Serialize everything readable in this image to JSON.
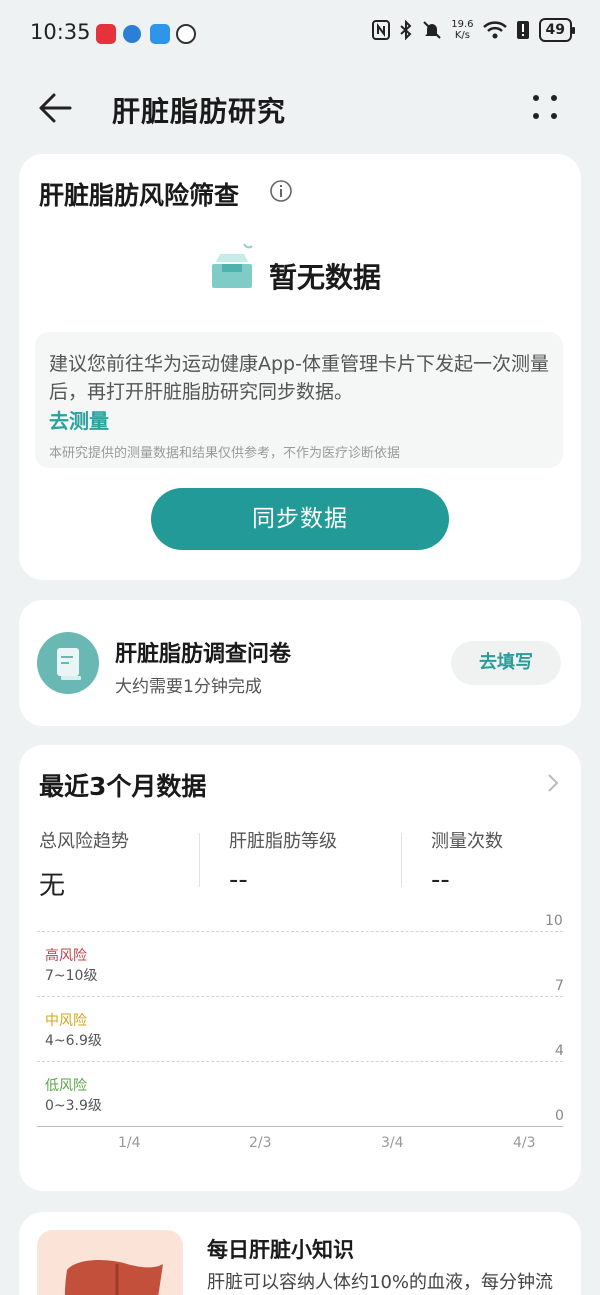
{
  "status_bar": {
    "time": "10:35",
    "net_speed_top": "19.6",
    "net_speed_bottom": "K/s",
    "battery": "49"
  },
  "header": {
    "title": "肝脏脂肪研究"
  },
  "screening": {
    "title": "肝脏脂肪风险筛查",
    "empty_text": "暂无数据",
    "notice_text": "建议您前往华为运动健康App-体重管理卡片下发起一次测量后，再打开肝脏脂肪研究同步数据。",
    "notice_link": "去测量",
    "disclaimer": "本研究提供的测量数据和结果仅供参考，不作为医疗诊断依据",
    "sync_button": "同步数据"
  },
  "questionnaire": {
    "title": "肝脏脂肪调查问卷",
    "subtitle": "大约需要1分钟完成",
    "button": "去填写"
  },
  "recent": {
    "title": "最近3个月数据",
    "stats": [
      {
        "label": "总风险趋势",
        "value": "无"
      },
      {
        "label": "肝脏脂肪等级",
        "value": "--"
      },
      {
        "label": "测量次数",
        "value": "--"
      }
    ],
    "y_axis": [
      "10",
      "7",
      "4",
      "0"
    ],
    "risk_levels": [
      {
        "name": "高风险",
        "range": "7~10级",
        "color": "#c2444a"
      },
      {
        "name": "中风险",
        "range": "4~6.9级",
        "color": "#d9a21b"
      },
      {
        "name": "低风险",
        "range": "0~3.9级",
        "color": "#5aa64a"
      }
    ],
    "x_axis": [
      "1/4",
      "2/3",
      "3/4",
      "4/3"
    ]
  },
  "knowledge": {
    "title": "每日肝脏小知识",
    "text": "肝脏可以容纳人体约10%的血液，每分钟流"
  },
  "colors": {
    "accent": "#229b98",
    "background": "#eef2f2"
  }
}
